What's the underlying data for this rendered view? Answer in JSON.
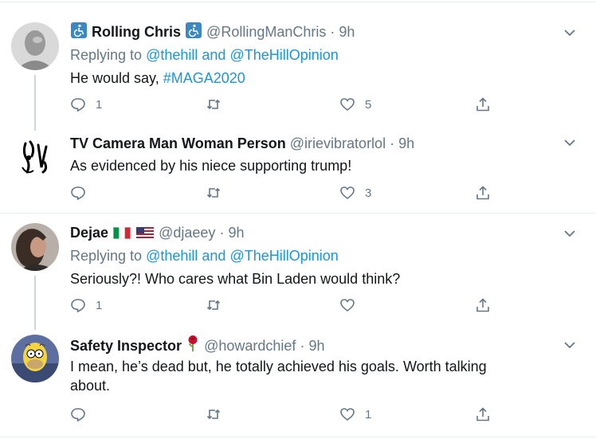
{
  "tweets": [
    {
      "display_name": "Rolling Chris",
      "name_emoji": "wheelchair-emoji",
      "handle": "@RollingManChris",
      "time": "9h",
      "replying_prefix": "Replying to",
      "replying_user1": "@thehill",
      "replying_and": "and",
      "replying_user2": "@TheHillOpinion",
      "text_plain": "He would say, ",
      "text_hashtag": "#MAGA2020",
      "replies": "1",
      "retweets": "",
      "likes": "5"
    },
    {
      "display_name": "TV Camera Man Woman Person",
      "handle": "@irievibratorlol",
      "time": "9h",
      "text_plain": "As evidenced by his niece supporting trump!",
      "replies": "",
      "retweets": "",
      "likes": "3"
    },
    {
      "display_name": "Dejae",
      "name_emoji": "flags-italy-usa",
      "handle": "@djaeey",
      "time": "9h",
      "replying_prefix": "Replying to",
      "replying_user1": "@thehill",
      "replying_and": "and",
      "replying_user2": "@TheHillOpinion",
      "text_plain": "Seriously?! Who cares what Bin Laden would think?",
      "replies": "1",
      "retweets": "",
      "likes": ""
    },
    {
      "display_name": "Safety Inspector",
      "name_emoji": "rose-emoji",
      "handle": "@howardchief",
      "time": "9h",
      "text_line1": "I mean, he’s dead but, he totally achieved his goals. Worth talking",
      "text_line2": "about.",
      "replies": "",
      "retweets": "",
      "likes": "1"
    }
  ],
  "separator": "·",
  "colors": {
    "link": "#1b95e0",
    "muted": "#657786",
    "text": "#14171a",
    "divider": "#e6ecf0",
    "thread": "#ccd6dd"
  }
}
